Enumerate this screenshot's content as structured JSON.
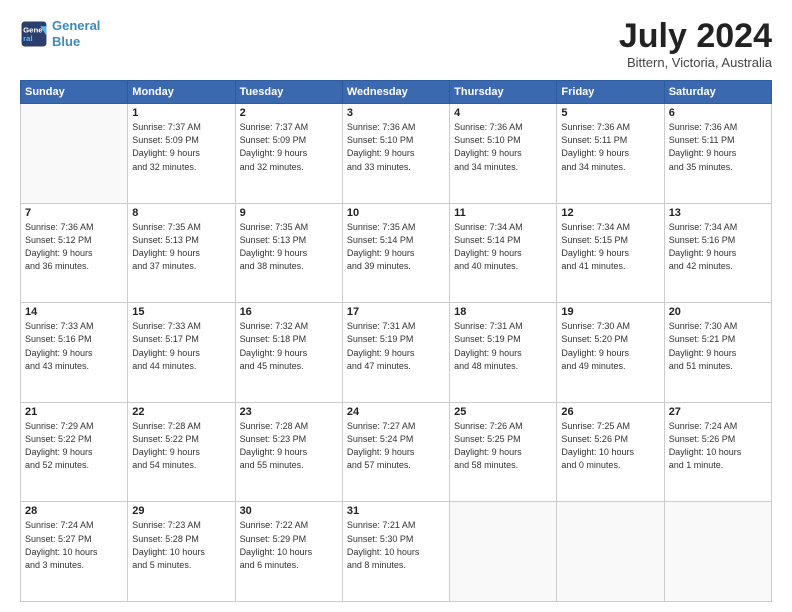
{
  "header": {
    "logo_line1": "General",
    "logo_line2": "Blue",
    "month_year": "July 2024",
    "location": "Bittern, Victoria, Australia"
  },
  "days_of_week": [
    "Sunday",
    "Monday",
    "Tuesday",
    "Wednesday",
    "Thursday",
    "Friday",
    "Saturday"
  ],
  "weeks": [
    [
      {
        "day": "",
        "info": ""
      },
      {
        "day": "1",
        "info": "Sunrise: 7:37 AM\nSunset: 5:09 PM\nDaylight: 9 hours\nand 32 minutes."
      },
      {
        "day": "2",
        "info": "Sunrise: 7:37 AM\nSunset: 5:09 PM\nDaylight: 9 hours\nand 32 minutes."
      },
      {
        "day": "3",
        "info": "Sunrise: 7:36 AM\nSunset: 5:10 PM\nDaylight: 9 hours\nand 33 minutes."
      },
      {
        "day": "4",
        "info": "Sunrise: 7:36 AM\nSunset: 5:10 PM\nDaylight: 9 hours\nand 34 minutes."
      },
      {
        "day": "5",
        "info": "Sunrise: 7:36 AM\nSunset: 5:11 PM\nDaylight: 9 hours\nand 34 minutes."
      },
      {
        "day": "6",
        "info": "Sunrise: 7:36 AM\nSunset: 5:11 PM\nDaylight: 9 hours\nand 35 minutes."
      }
    ],
    [
      {
        "day": "7",
        "info": "Sunrise: 7:36 AM\nSunset: 5:12 PM\nDaylight: 9 hours\nand 36 minutes."
      },
      {
        "day": "8",
        "info": "Sunrise: 7:35 AM\nSunset: 5:13 PM\nDaylight: 9 hours\nand 37 minutes."
      },
      {
        "day": "9",
        "info": "Sunrise: 7:35 AM\nSunset: 5:13 PM\nDaylight: 9 hours\nand 38 minutes."
      },
      {
        "day": "10",
        "info": "Sunrise: 7:35 AM\nSunset: 5:14 PM\nDaylight: 9 hours\nand 39 minutes."
      },
      {
        "day": "11",
        "info": "Sunrise: 7:34 AM\nSunset: 5:14 PM\nDaylight: 9 hours\nand 40 minutes."
      },
      {
        "day": "12",
        "info": "Sunrise: 7:34 AM\nSunset: 5:15 PM\nDaylight: 9 hours\nand 41 minutes."
      },
      {
        "day": "13",
        "info": "Sunrise: 7:34 AM\nSunset: 5:16 PM\nDaylight: 9 hours\nand 42 minutes."
      }
    ],
    [
      {
        "day": "14",
        "info": "Sunrise: 7:33 AM\nSunset: 5:16 PM\nDaylight: 9 hours\nand 43 minutes."
      },
      {
        "day": "15",
        "info": "Sunrise: 7:33 AM\nSunset: 5:17 PM\nDaylight: 9 hours\nand 44 minutes."
      },
      {
        "day": "16",
        "info": "Sunrise: 7:32 AM\nSunset: 5:18 PM\nDaylight: 9 hours\nand 45 minutes."
      },
      {
        "day": "17",
        "info": "Sunrise: 7:31 AM\nSunset: 5:19 PM\nDaylight: 9 hours\nand 47 minutes."
      },
      {
        "day": "18",
        "info": "Sunrise: 7:31 AM\nSunset: 5:19 PM\nDaylight: 9 hours\nand 48 minutes."
      },
      {
        "day": "19",
        "info": "Sunrise: 7:30 AM\nSunset: 5:20 PM\nDaylight: 9 hours\nand 49 minutes."
      },
      {
        "day": "20",
        "info": "Sunrise: 7:30 AM\nSunset: 5:21 PM\nDaylight: 9 hours\nand 51 minutes."
      }
    ],
    [
      {
        "day": "21",
        "info": "Sunrise: 7:29 AM\nSunset: 5:22 PM\nDaylight: 9 hours\nand 52 minutes."
      },
      {
        "day": "22",
        "info": "Sunrise: 7:28 AM\nSunset: 5:22 PM\nDaylight: 9 hours\nand 54 minutes."
      },
      {
        "day": "23",
        "info": "Sunrise: 7:28 AM\nSunset: 5:23 PM\nDaylight: 9 hours\nand 55 minutes."
      },
      {
        "day": "24",
        "info": "Sunrise: 7:27 AM\nSunset: 5:24 PM\nDaylight: 9 hours\nand 57 minutes."
      },
      {
        "day": "25",
        "info": "Sunrise: 7:26 AM\nSunset: 5:25 PM\nDaylight: 9 hours\nand 58 minutes."
      },
      {
        "day": "26",
        "info": "Sunrise: 7:25 AM\nSunset: 5:26 PM\nDaylight: 10 hours\nand 0 minutes."
      },
      {
        "day": "27",
        "info": "Sunrise: 7:24 AM\nSunset: 5:26 PM\nDaylight: 10 hours\nand 1 minute."
      }
    ],
    [
      {
        "day": "28",
        "info": "Sunrise: 7:24 AM\nSunset: 5:27 PM\nDaylight: 10 hours\nand 3 minutes."
      },
      {
        "day": "29",
        "info": "Sunrise: 7:23 AM\nSunset: 5:28 PM\nDaylight: 10 hours\nand 5 minutes."
      },
      {
        "day": "30",
        "info": "Sunrise: 7:22 AM\nSunset: 5:29 PM\nDaylight: 10 hours\nand 6 minutes."
      },
      {
        "day": "31",
        "info": "Sunrise: 7:21 AM\nSunset: 5:30 PM\nDaylight: 10 hours\nand 8 minutes."
      },
      {
        "day": "",
        "info": ""
      },
      {
        "day": "",
        "info": ""
      },
      {
        "day": "",
        "info": ""
      }
    ]
  ]
}
